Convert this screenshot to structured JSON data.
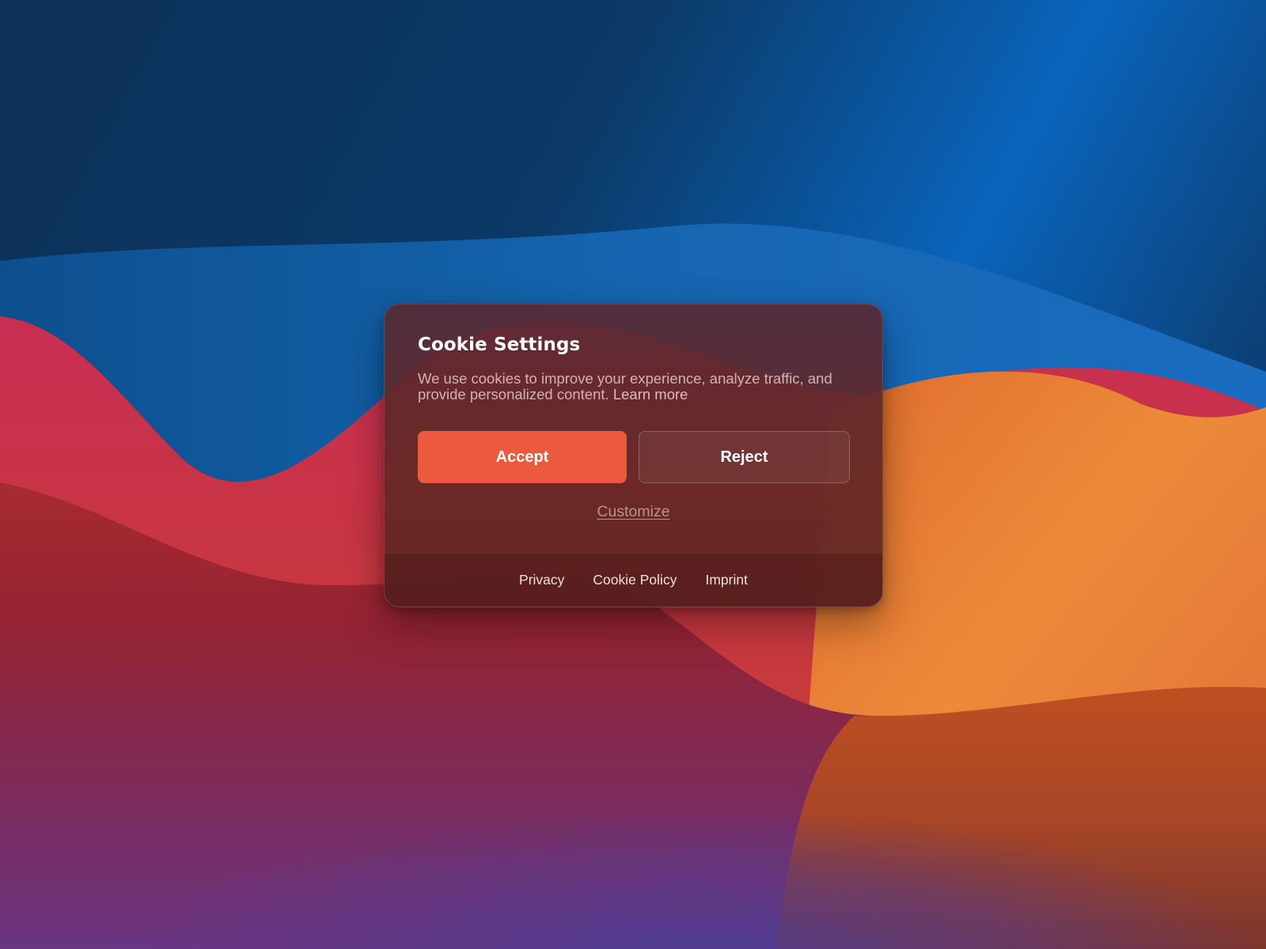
{
  "background": {
    "colors": {
      "sky_dark": "#0c3058",
      "sky_bright": "#0b6ac4",
      "blue_wave": "#1160aa",
      "crimson": "#c62f4a",
      "red": "#b8283a",
      "orange": "#e8843a",
      "burnt_orange": "#c45a1c",
      "purple": "#6a3a86",
      "violet": "#4e3f92"
    }
  },
  "dialog": {
    "title": "Cookie Settings",
    "body_text": "We use cookies to improve your experience, analyze traffic, and provide personalized content.",
    "learn_more_label": "Learn more",
    "accept_label": "Accept",
    "reject_label": "Reject",
    "customize_label": "Customize",
    "colors": {
      "accent": "#ec5a3e",
      "surface": "#5e2a30"
    }
  },
  "footer": {
    "links": [
      {
        "label": "Privacy"
      },
      {
        "label": "Cookie Policy"
      },
      {
        "label": "Imprint"
      }
    ]
  }
}
